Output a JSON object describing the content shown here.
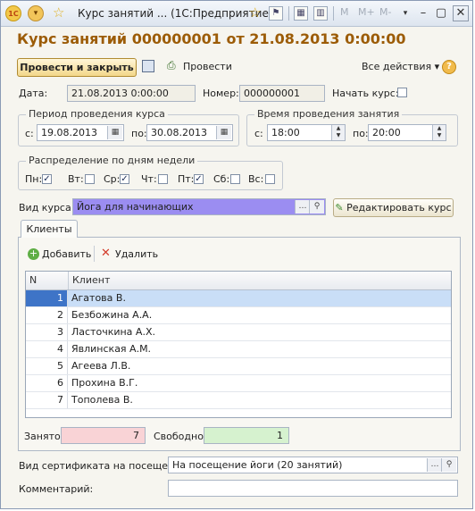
{
  "window": {
    "title": "Курс занятий ... (1С:Предприятие)",
    "toolbar_m": [
      "M",
      "M+",
      "M-"
    ]
  },
  "document": {
    "title": "Курс занятий 000000001 от 21.08.2013 0:00:00"
  },
  "commandbar": {
    "post_close": "Провести и закрыть",
    "post": "Провести",
    "all_actions": "Все действия ▾",
    "help": "?"
  },
  "header": {
    "date_label": "Дата:",
    "date_value": "21.08.2013  0:00:00",
    "number_label": "Номер:",
    "number_value": "000000001",
    "start_label": "Начать курс:"
  },
  "period": {
    "title": "Период проведения курса",
    "from_label": "с:",
    "from_value": "19.08.2013",
    "to_label": "по:",
    "to_value": "30.08.2013"
  },
  "time": {
    "title": "Время проведения занятия",
    "from_label": "с:",
    "from_value": "18:00",
    "to_label": "по:",
    "to_value": "20:00"
  },
  "days": {
    "title": "Распределение по дням недели",
    "items": [
      {
        "label": "Пн:",
        "checked": true
      },
      {
        "label": "Вт:",
        "checked": false
      },
      {
        "label": "Ср:",
        "checked": true
      },
      {
        "label": "Чт:",
        "checked": false
      },
      {
        "label": "Пт:",
        "checked": true
      },
      {
        "label": "Сб:",
        "checked": false
      },
      {
        "label": "Вс:",
        "checked": false
      }
    ]
  },
  "course": {
    "label": "Вид курса:",
    "value": "Йога для начинающих",
    "edit_button": "Редактировать курс",
    "highlight": "#9b8df1"
  },
  "tab": {
    "label": "Клиенты"
  },
  "clients_toolbar": {
    "add": "Добавить",
    "delete": "Удалить"
  },
  "table": {
    "headers": [
      "N",
      "Клиент"
    ],
    "rows": [
      {
        "n": "1",
        "client": "Агатова В."
      },
      {
        "n": "2",
        "client": "Безбожина А.А."
      },
      {
        "n": "3",
        "client": "Ласточкина А.Х."
      },
      {
        "n": "4",
        "client": "Явлинская А.М."
      },
      {
        "n": "5",
        "client": "Агеева Л.В."
      },
      {
        "n": "6",
        "client": "Прохина В.Г."
      },
      {
        "n": "7",
        "client": "Тополева В."
      }
    ]
  },
  "counters": {
    "busy_label": "Занято:",
    "busy_value": "7",
    "busy_color": "#f9d3d6",
    "free_label": "Свободно:",
    "free_value": "1",
    "free_color": "#d6f2cf"
  },
  "certificate": {
    "label": "Вид сертификата на посещение:",
    "value": "На посещение йоги (20 занятий)"
  },
  "comment": {
    "label": "Комментарий:",
    "value": ""
  }
}
